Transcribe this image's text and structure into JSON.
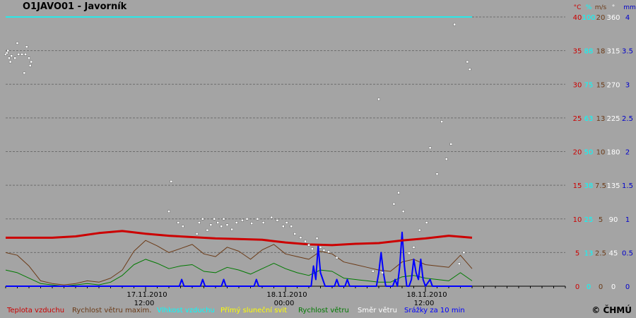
{
  "title": "O1JAVO01 - Javorník",
  "copyright": "© ČHMÚ",
  "colors": {
    "background": "#a4a4a4",
    "grid": "#6e6e6e",
    "temperature": "#cc0000",
    "gust": "#6b3a16",
    "humidity": "#00ffff",
    "sunshine": "#ffff00",
    "wind_speed": "#007a00",
    "wind_direction": "#ffffff",
    "precipitation": "#0000ff",
    "axis_mm": "#0000cc"
  },
  "legend": [
    {
      "key": "temperature",
      "label": "Teplota vzduchu"
    },
    {
      "key": "gust",
      "label": "Rychlost větru maxim."
    },
    {
      "key": "humidity",
      "label": "Vlhkost vzduchu"
    },
    {
      "key": "sunshine",
      "label": "Přímý sluneční svit"
    },
    {
      "key": "wind_speed",
      "label": "Rychlost větru"
    },
    {
      "key": "wind_direction",
      "label": "Směr větru"
    },
    {
      "key": "precipitation",
      "label": "Srážky za 10 min"
    }
  ],
  "chart_data": {
    "type": "line",
    "x_range_hours": [
      0,
      48
    ],
    "x_ticks": [
      {
        "hour": 12,
        "label1": "17.11.2010",
        "label2": "12:00"
      },
      {
        "hour": 24,
        "label1": "18.11.2010",
        "label2": "00:00"
      },
      {
        "hour": 36,
        "label1": "18.11.2010",
        "label2": "12:00"
      }
    ],
    "axes": [
      {
        "key": "temp",
        "unit": "°C",
        "color": "#cc0000",
        "ticks": [
          "0",
          "5",
          "10",
          "15",
          "20",
          "25",
          "30",
          "35",
          "40"
        ]
      },
      {
        "key": "hum",
        "unit": "%",
        "color": "#00ffff",
        "ticks": [
          "0",
          "13",
          "25",
          "38",
          "50",
          "63",
          "75",
          "88",
          "100"
        ]
      },
      {
        "key": "wind",
        "unit": "m/s",
        "color": "#6b3a16",
        "ticks": [
          "0",
          "2.5",
          "5",
          "7.5",
          "10",
          "13",
          "15",
          "18",
          "20"
        ]
      },
      {
        "key": "dir",
        "unit": "°",
        "color": "#ffffff",
        "ticks": [
          "0",
          "45",
          "90",
          "135",
          "180",
          "225",
          "270",
          "315",
          "360"
        ]
      },
      {
        "key": "mm",
        "unit": "mm",
        "color": "#0000cc",
        "ticks": [
          "0",
          "0.5",
          "1",
          "1.5",
          "2",
          "2.5",
          "3",
          "3.5",
          "4"
        ]
      }
    ],
    "series": [
      {
        "key": "temperature",
        "axis": "temp",
        "x_hours": [
          0,
          4,
          6,
          8,
          10,
          12,
          14,
          16,
          18,
          20,
          22,
          24,
          26,
          28,
          30,
          32,
          34,
          36,
          38,
          40
        ],
        "values": [
          7.2,
          7.2,
          7.4,
          7.9,
          8.2,
          7.8,
          7.5,
          7.3,
          7.1,
          7.0,
          6.9,
          6.5,
          6.2,
          6.1,
          6.3,
          6.4,
          6.8,
          7.1,
          7.5,
          7.2
        ]
      },
      {
        "key": "humidity",
        "axis": "hum",
        "x_hours": [
          0,
          40
        ],
        "values": [
          100,
          100
        ]
      },
      {
        "key": "gust",
        "axis": "wind",
        "x_hours": [
          0,
          1,
          2,
          3,
          4,
          5,
          6,
          7,
          8,
          9,
          10,
          11,
          12,
          13,
          14,
          15,
          16,
          17,
          18,
          19,
          20,
          21,
          22,
          23,
          24,
          25,
          26,
          27,
          28,
          29,
          30,
          31,
          32,
          33,
          34,
          35,
          36,
          37,
          38,
          39,
          40
        ],
        "values": [
          2.5,
          2.3,
          1.5,
          0.4,
          0.2,
          0.1,
          0.2,
          0.4,
          0.3,
          0.6,
          1.2,
          2.6,
          3.4,
          3.0,
          2.5,
          2.8,
          3.1,
          2.4,
          2.2,
          2.9,
          2.6,
          2.0,
          2.7,
          3.1,
          2.4,
          2.2,
          2.0,
          2.6,
          2.4,
          1.8,
          1.6,
          1.4,
          1.2,
          1.1,
          1.8,
          2.0,
          1.6,
          1.5,
          1.4,
          2.3,
          1.3
        ]
      },
      {
        "key": "wind_speed",
        "axis": "wind",
        "x_hours": [
          0,
          1,
          2,
          3,
          4,
          5,
          6,
          7,
          8,
          9,
          10,
          11,
          12,
          13,
          14,
          15,
          16,
          17,
          18,
          19,
          20,
          21,
          22,
          23,
          24,
          25,
          26,
          27,
          28,
          29,
          30,
          31,
          32,
          33,
          34,
          35,
          36,
          37,
          38,
          39,
          40
        ],
        "values": [
          1.2,
          1.0,
          0.6,
          0.2,
          0.1,
          0,
          0.1,
          0.2,
          0.1,
          0.3,
          0.8,
          1.6,
          2.0,
          1.7,
          1.3,
          1.5,
          1.6,
          1.1,
          1.0,
          1.4,
          1.2,
          0.9,
          1.3,
          1.7,
          1.3,
          1.0,
          0.8,
          1.2,
          1.1,
          0.6,
          0.5,
          0.4,
          0.3,
          0.3,
          0.7,
          0.8,
          0.6,
          0.5,
          0.4,
          1.0,
          0.4
        ]
      },
      {
        "key": "precipitation",
        "axis": "mm",
        "x_hours": [
          0,
          14.9,
          15.1,
          15.3,
          15.5,
          16.7,
          16.9,
          17.1,
          18.5,
          18.7,
          18.9,
          21.3,
          21.5,
          21.7,
          26.2,
          26.4,
          26.6,
          26.8,
          27.0,
          27.2,
          27.4,
          27.6,
          28.2,
          28.4,
          28.6,
          29.1,
          29.3,
          29.5,
          31.8,
          32.0,
          32.2,
          32.4,
          32.6,
          32.8,
          33.2,
          33.4,
          33.6,
          33.8,
          34.0,
          34.2,
          34.4,
          34.6,
          34.8,
          35.0,
          35.2,
          35.4,
          35.6,
          35.8,
          36.0,
          36.4,
          36.6,
          36.8,
          40
        ],
        "values": [
          0,
          0,
          0.1,
          0,
          0,
          0,
          0.1,
          0,
          0,
          0.1,
          0,
          0,
          0.1,
          0,
          0,
          0.3,
          0.1,
          0.6,
          0.2,
          0.1,
          0,
          0,
          0,
          0.1,
          0,
          0,
          0.1,
          0,
          0,
          0.2,
          0.5,
          0.2,
          0,
          0,
          0,
          0.1,
          0,
          0.3,
          0.8,
          0.3,
          0,
          0,
          0.1,
          0.4,
          0.2,
          0.1,
          0.4,
          0.1,
          0,
          0.1,
          0,
          0,
          0
        ]
      },
      {
        "key": "wind_direction",
        "axis": "dir",
        "type": "scatter",
        "x_hours": [
          0,
          0.1,
          0.2,
          0.3,
          0.4,
          0.5,
          0.8,
          1.0,
          1.1,
          1.4,
          1.6,
          1.7,
          1.8,
          2.0,
          2.1,
          2.2,
          14.0,
          14.2,
          14.8,
          15.2,
          16.4,
          16.6,
          16.9,
          17.3,
          17.6,
          17.9,
          18.2,
          18.5,
          18.7,
          19.0,
          19.4,
          19.8,
          20.3,
          20.7,
          21.1,
          21.6,
          22.1,
          22.8,
          23.3,
          23.8,
          24.1,
          24.5,
          24.8,
          25.3,
          25.7,
          26.0,
          26.3,
          26.7,
          27.0,
          27.3,
          27.7,
          28.4,
          31.5,
          32.0,
          32.3,
          33.3,
          33.7,
          34.1,
          34.6,
          35.0,
          35.5,
          36.1,
          36.4,
          37.0,
          37.4,
          37.8,
          38.2,
          38.5,
          38.9,
          39.3,
          39.6,
          39.8
        ],
        "values": [
          310,
          312,
          315,
          305,
          300,
          308,
          305,
          325,
          310,
          310,
          285,
          310,
          320,
          305,
          295,
          300,
          100,
          140,
          85,
          80,
          70,
          85,
          90,
          75,
          82,
          90,
          85,
          80,
          90,
          82,
          76,
          85,
          88,
          90,
          84,
          90,
          85,
          92,
          88,
          80,
          85,
          80,
          70,
          65,
          60,
          55,
          50,
          64,
          52,
          48,
          46,
          38,
          20,
          250,
          18,
          110,
          125,
          100,
          44,
          52,
          75,
          85,
          185,
          150,
          220,
          170,
          190,
          350,
          30,
          45,
          300,
          290
        ]
      }
    ]
  }
}
